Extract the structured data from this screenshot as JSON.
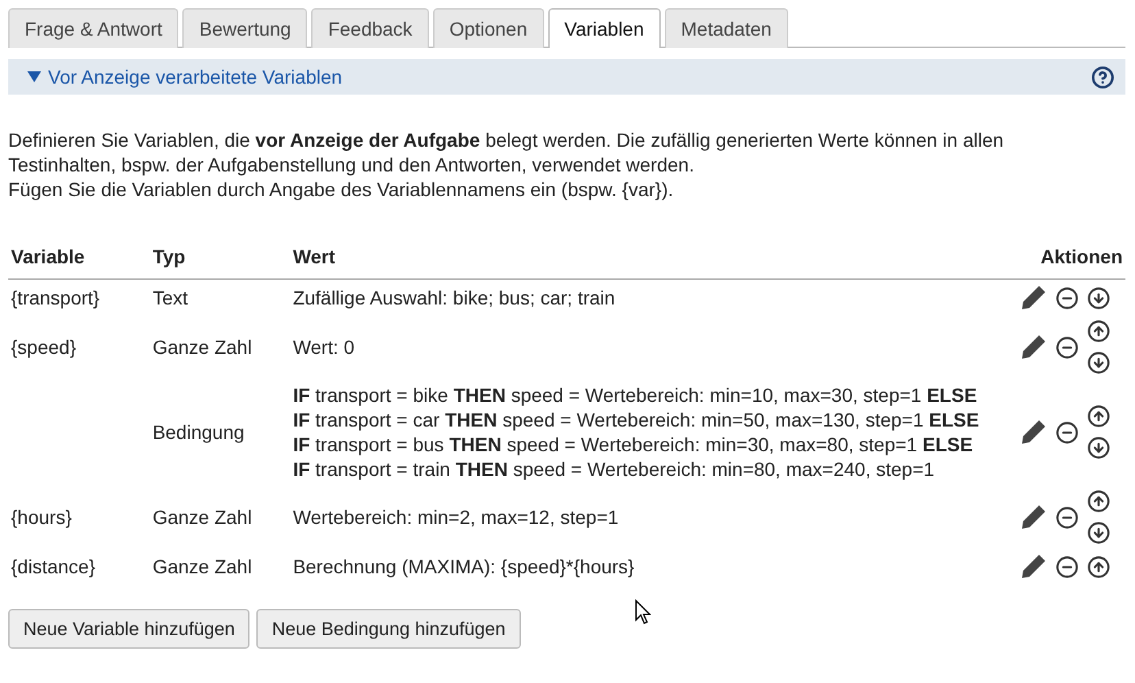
{
  "tabs": [
    {
      "label": "Frage & Antwort",
      "selected": false
    },
    {
      "label": "Bewertung",
      "selected": false
    },
    {
      "label": "Feedback",
      "selected": false
    },
    {
      "label": "Optionen",
      "selected": false
    },
    {
      "label": "Variablen",
      "selected": true
    },
    {
      "label": "Metadaten",
      "selected": false
    }
  ],
  "section": {
    "title": "Vor Anzeige verarbeitete Variablen",
    "expanded": true
  },
  "description": [
    "Definieren Sie Variablen, die **vor Anzeige der Aufgabe** belegt werden. Die zufällig generierten Werte können in allen Testinhalten, bspw. der Aufgabenstellung und den Antworten, verwendet werden.",
    "Fügen Sie die Variablen durch Angabe des Variablennamens ein (bspw. {var})."
  ],
  "table": {
    "columns": [
      "Variable",
      "Typ",
      "Wert",
      "Aktionen"
    ],
    "rows": [
      {
        "variable": "{transport}",
        "type": "Text",
        "value": [
          "Zufällige Auswahl: bike; bus; car; train"
        ],
        "can_move_up": false,
        "can_move_down": true
      },
      {
        "variable": "{speed}",
        "type": "Ganze Zahl",
        "value": [
          "Wert: 0"
        ],
        "can_move_up": true,
        "can_move_down": true
      },
      {
        "type": "Bedingung",
        "value": [
          "**IF** transport = bike **THEN** speed = Wertebereich: min=10, max=30, step=1 **ELSE**",
          "**IF** transport = car **THEN** speed = Wertebereich: min=50, max=130, step=1 **ELSE**",
          "**IF** transport = bus **THEN** speed = Wertebereich: min=30, max=80, step=1 **ELSE**",
          "**IF** transport = train **THEN** speed = Wertebereich: min=80, max=240, step=1"
        ],
        "can_move_up": true,
        "can_move_down": true
      },
      {
        "variable": "{hours}",
        "type": "Ganze Zahl",
        "value": [
          "Wertebereich: min=2, max=12, step=1"
        ],
        "can_move_up": true,
        "can_move_down": true
      },
      {
        "variable": "{distance}",
        "type": "Ganze Zahl",
        "value": [
          "Berechnung (MAXIMA): {speed}*{hours}"
        ],
        "can_move_up": true,
        "can_move_down": false
      }
    ]
  },
  "buttons": [
    "Neue Variable hinzufügen",
    "Neue Bedingung hinzufügen"
  ]
}
